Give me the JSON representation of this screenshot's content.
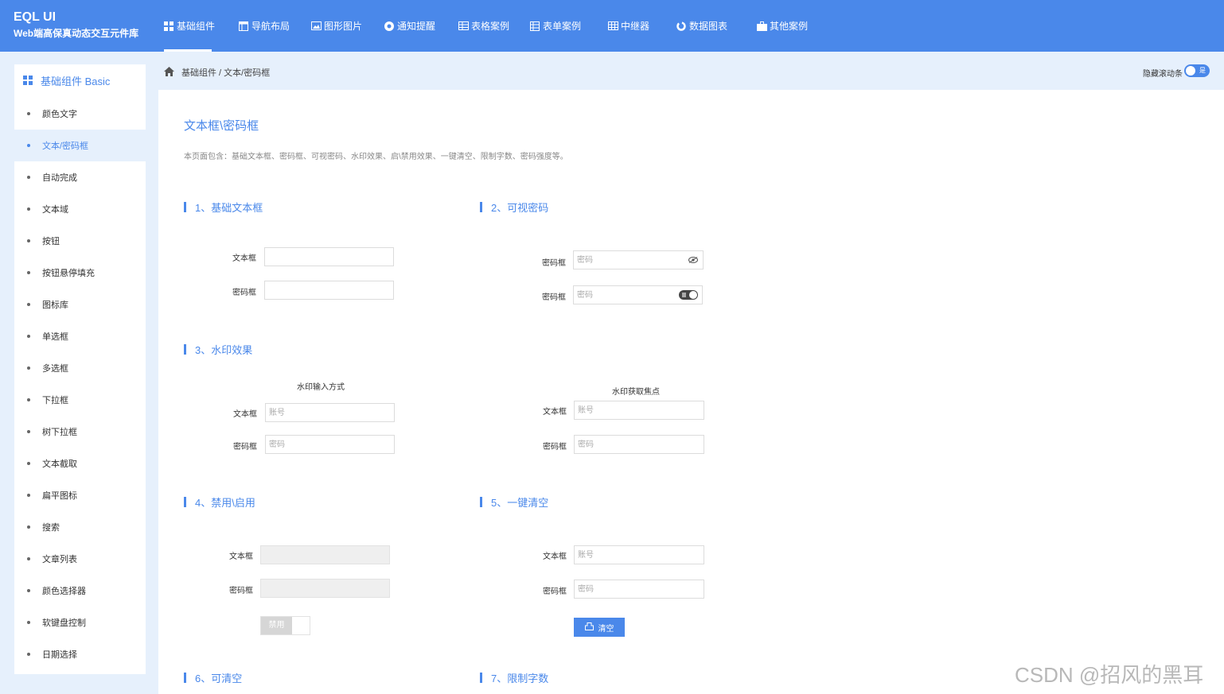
{
  "brand": {
    "title": "EQL UI",
    "subtitle": "Web端高保真动态交互元件库"
  },
  "nav": [
    {
      "label": "基础组件",
      "icon": "grid-icon",
      "active": true
    },
    {
      "label": "导航布局",
      "icon": "layout-icon"
    },
    {
      "label": "图形图片",
      "icon": "image-icon"
    },
    {
      "label": "通知提醒",
      "icon": "bell-icon"
    },
    {
      "label": "表格案例",
      "icon": "table-icon"
    },
    {
      "label": "表单案例",
      "icon": "form-icon"
    },
    {
      "label": "中继器",
      "icon": "repeater-icon"
    },
    {
      "label": "数据图表",
      "icon": "chart-icon"
    },
    {
      "label": "其他案例",
      "icon": "briefcase-icon"
    }
  ],
  "sidebar": {
    "header": "基础组件 Basic",
    "items": [
      {
        "label": "颜色文字"
      },
      {
        "label": "文本/密码框",
        "active": true
      },
      {
        "label": "自动完成"
      },
      {
        "label": "文本域"
      },
      {
        "label": "按钮"
      },
      {
        "label": "按钮悬停填充"
      },
      {
        "label": "图标库"
      },
      {
        "label": "单选框"
      },
      {
        "label": "多选框"
      },
      {
        "label": "下拉框"
      },
      {
        "label": "树下拉框"
      },
      {
        "label": "文本截取"
      },
      {
        "label": "扁平图标"
      },
      {
        "label": "搜索"
      },
      {
        "label": "文章列表"
      },
      {
        "label": "颜色选择器"
      },
      {
        "label": "软键盘控制"
      },
      {
        "label": "日期选择"
      }
    ]
  },
  "breadcrumb": "基础组件 / 文本/密码框",
  "scroll_toggle": {
    "label": "隐藏滚动条",
    "state": "是"
  },
  "page": {
    "title": "文本框\\密码框",
    "desc": "本页面包含：基础文本框、密码框、可视密码、水印效果、启\\禁用效果、一键清空、限制字数、密码强度等。"
  },
  "sections": {
    "s1": {
      "title": "1、基础文本框",
      "label_text": "文本框",
      "label_pwd": "密码框"
    },
    "s2": {
      "title": "2、可视密码",
      "label_pwd1": "密码框",
      "label_pwd2": "密码框",
      "placeholder": "密码"
    },
    "s3": {
      "title": "3、水印效果",
      "left_caption": "水印输入方式",
      "right_caption": "水印获取焦点",
      "label_text": "文本框",
      "label_pwd": "密码框",
      "placeholder_account": "账号",
      "placeholder_pwd": "密码"
    },
    "s4": {
      "title": "4、禁用\\启用",
      "label_text": "文本框",
      "label_pwd": "密码框",
      "toggle_label": "禁用"
    },
    "s5": {
      "title": "5、一键清空",
      "label_text": "文本框",
      "label_pwd": "密码框",
      "placeholder_account": "账号",
      "placeholder_pwd": "密码",
      "button": "清空"
    },
    "s6": {
      "title": "6、可清空"
    },
    "s7": {
      "title": "7、限制字数"
    }
  },
  "watermark": "CSDN @招风的黑耳",
  "colors": {
    "primary": "#4a88ea",
    "light_bg": "#e6f0fc"
  }
}
